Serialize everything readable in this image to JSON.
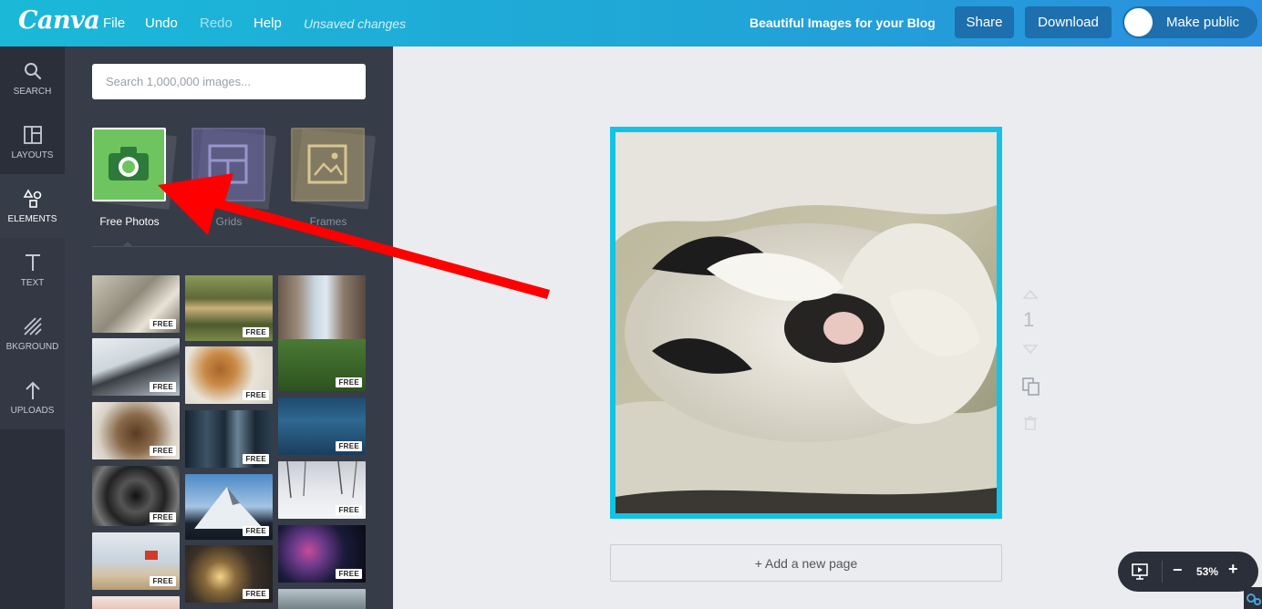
{
  "header": {
    "logo": "Canva",
    "menu": {
      "file": "File",
      "undo": "Undo",
      "redo": "Redo",
      "help": "Help",
      "status": "Unsaved changes"
    },
    "doc_title": "Beautiful Images for your Blog",
    "share_label": "Share",
    "download_label": "Download",
    "make_public_label": "Make public"
  },
  "sidebar": {
    "items": [
      {
        "label": "SEARCH",
        "icon": "search-icon"
      },
      {
        "label": "LAYOUTS",
        "icon": "layouts-icon"
      },
      {
        "label": "ELEMENTS",
        "icon": "elements-icon"
      },
      {
        "label": "TEXT",
        "icon": "text-icon"
      },
      {
        "label": "BKGROUND",
        "icon": "background-icon"
      },
      {
        "label": "UPLOADS",
        "icon": "upload-icon"
      }
    ],
    "active": "ELEMENTS"
  },
  "panel": {
    "search_placeholder": "Search 1,000,000 images...",
    "categories": [
      {
        "label": "Free Photos",
        "icon": "camera-icon",
        "active": true
      },
      {
        "label": "Grids",
        "icon": "grid-icon",
        "active": false
      },
      {
        "label": "Frames",
        "icon": "frame-icon",
        "active": false
      }
    ],
    "badge_text": "FREE",
    "photos": [
      "cat-bed",
      "canyon-river",
      "city-street",
      "laptop-hands",
      "burger-fries",
      "coffee-beans",
      "skyscrapers",
      "ocean-waves",
      "snowy-trees",
      "spiral-stairs",
      "mountain-peak",
      "night-sky",
      "lifeguard-tower",
      "sparkler-girl"
    ]
  },
  "canvas": {
    "page_number": "1",
    "add_page_label": "+ Add a new page",
    "frame_color": "#13c3e6"
  },
  "zoom": {
    "value": "53%",
    "minus": "−",
    "plus": "+"
  },
  "colors": {
    "topbar_start": "#1bb8d8",
    "topbar_end": "#2b8fe0",
    "button_bg": "#1d6fae",
    "rail_bg": "#2a2f3a",
    "panel_bg": "#363c48",
    "canvas_bg": "#ebecef",
    "annotation_arrow": "#ff0000"
  }
}
